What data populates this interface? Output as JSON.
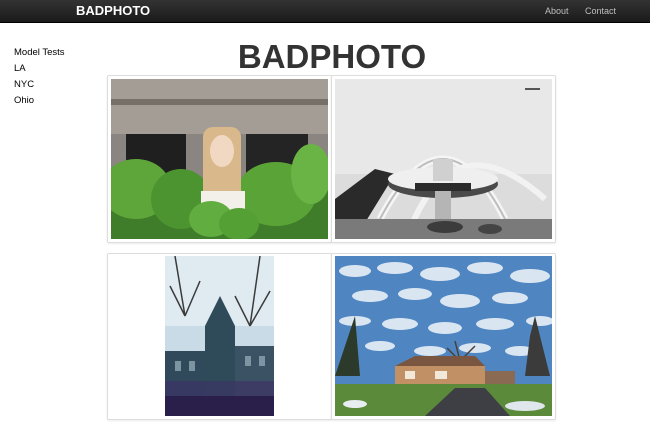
{
  "navbar": {
    "brand": "BADPHOTO",
    "links": [
      "About",
      "Contact"
    ]
  },
  "sidebar": {
    "items": [
      "Model Tests",
      "LA",
      "NYC",
      "Ohio"
    ]
  },
  "main": {
    "title": "BADPHOTO"
  },
  "colors": {
    "navbar_bg": "#222222",
    "nav_link": "#bfbfbf",
    "title": "#333333",
    "thumb_border": "#dddddd"
  }
}
